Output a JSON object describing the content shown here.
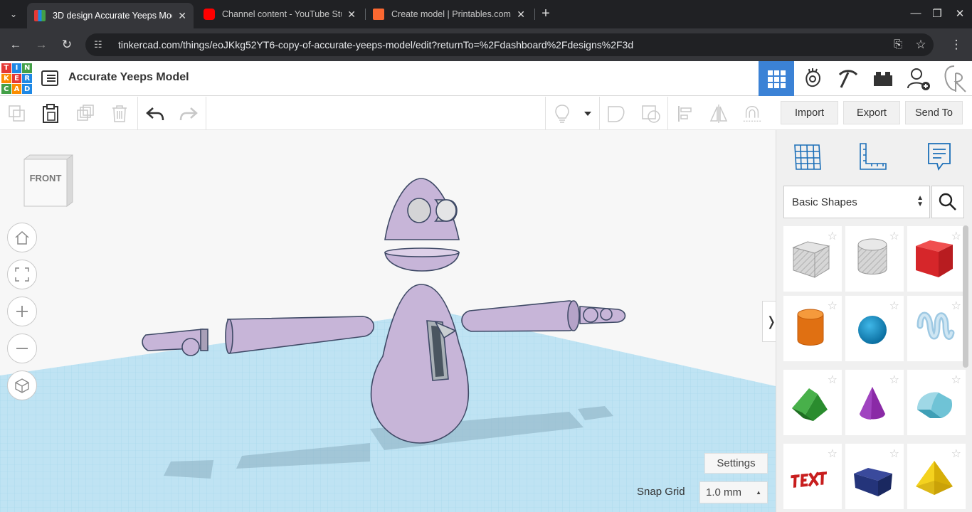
{
  "browser": {
    "tabs": [
      {
        "title": "3D design Accurate Yeeps Mod",
        "active": true
      },
      {
        "title": "Channel content - YouTube Stu",
        "active": false
      },
      {
        "title": "Create model | Printables.com",
        "active": false
      }
    ],
    "new_tab": "+",
    "url": "tinkercad.com/things/eoJKkg52YT6-copy-of-accurate-yeeps-model/edit?returnTo=%2Fdashboard%2Fdesigns%2F3d"
  },
  "app": {
    "logo_letters": [
      "T",
      "I",
      "N",
      "K",
      "E",
      "R",
      "C",
      "A",
      "D"
    ],
    "logo_colors": [
      "#e53935",
      "#1e88e5",
      "#43a047",
      "#fb8c00",
      "#e53935",
      "#1e88e5",
      "#43a047",
      "#fb8c00",
      "#1e88e5"
    ],
    "design_title": "Accurate Yeeps Model",
    "accent": "#3b82d6"
  },
  "toolbar": {
    "import_label": "Import",
    "export_label": "Export",
    "send_to_label": "Send To"
  },
  "viewport": {
    "viewcube_label": "FRONT",
    "settings_label": "Settings",
    "snap_grid_label": "Snap Grid",
    "snap_grid_value": "1.0 mm"
  },
  "panel": {
    "category": "Basic Shapes",
    "shapes": [
      "Box (hole)",
      "Cylinder (hole)",
      "Box",
      "Cylinder",
      "Sphere",
      "Scribble",
      "Roof",
      "Cone",
      "Round Roof",
      "Text",
      "Wedge",
      "Pyramid"
    ]
  }
}
